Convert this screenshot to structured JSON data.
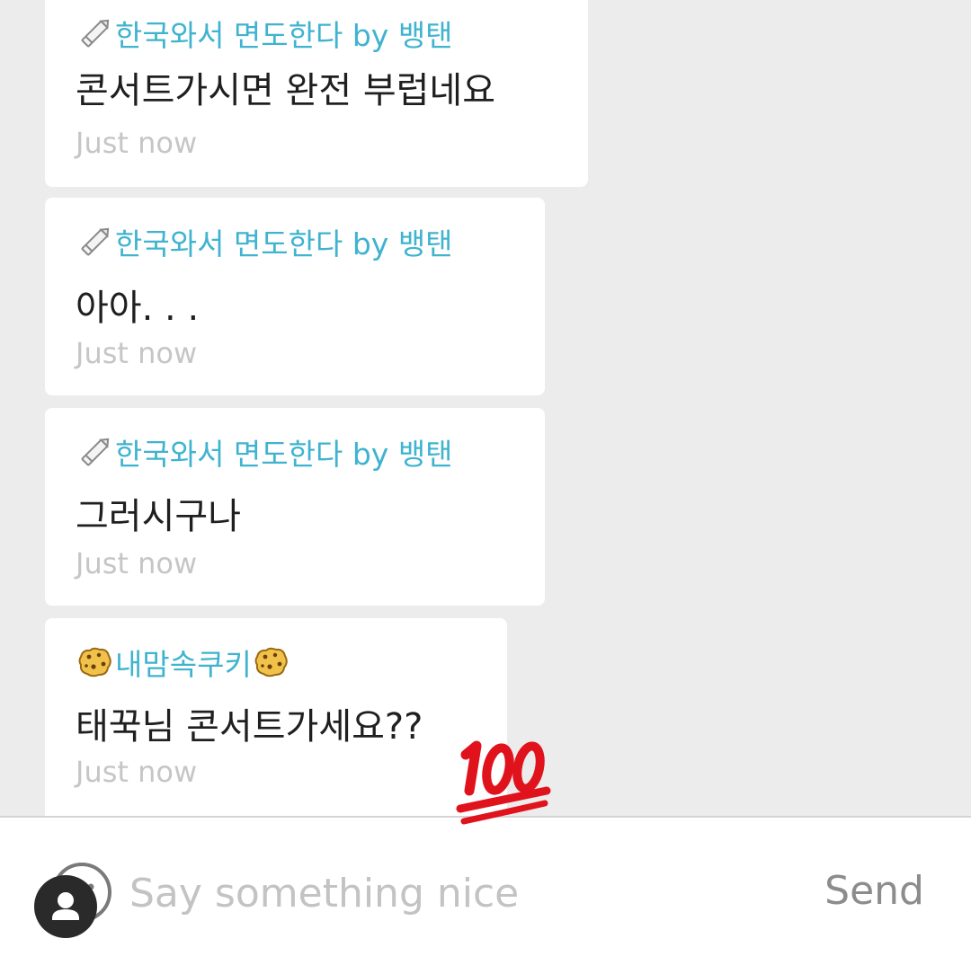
{
  "comments": [
    {
      "author": "한국와서 면도한다 by 뱅탠",
      "author_icon": "pencil-icon",
      "text": "콘서트가시면 완전 부럽네요",
      "time": "Just now"
    },
    {
      "author": "한국와서 면도한다 by 뱅탠",
      "author_icon": "pencil-icon",
      "text": "아아. . .",
      "time": "Just now"
    },
    {
      "author": "한국와서 면도한다 by 뱅탠",
      "author_icon": "pencil-icon",
      "text": "그러시구나",
      "time": "Just now"
    },
    {
      "author": "내맘속쿠키",
      "author_icon": "cookie-icon",
      "text": "태꾹님 콘서트가세요??",
      "time": "Just now"
    }
  ],
  "composer": {
    "placeholder": "Say something nice",
    "send_label": "Send"
  },
  "colors": {
    "author": "#3fb3cf",
    "time": "#c6c6c6",
    "feed_background": "#ececec",
    "badge_red": "#e0121b"
  },
  "overlay_icon": "hundred-points-icon"
}
